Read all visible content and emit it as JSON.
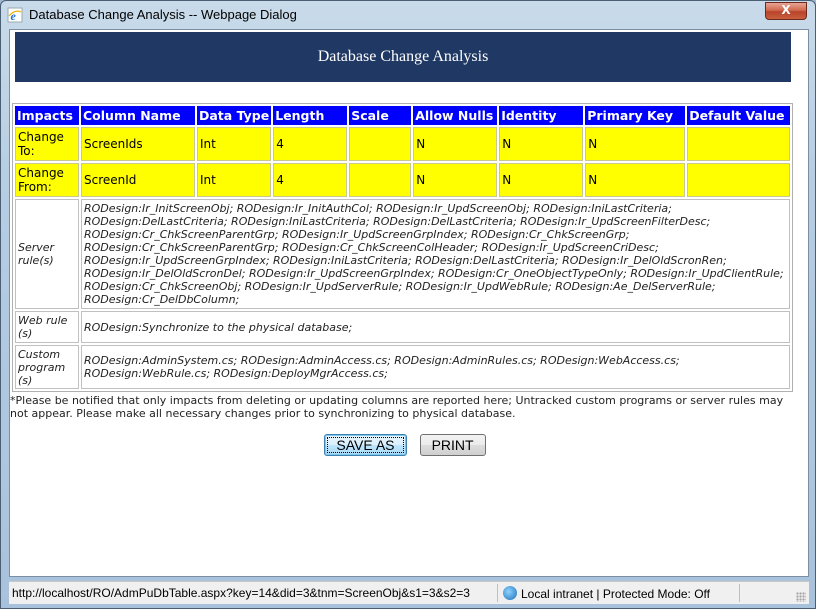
{
  "window": {
    "title": "Database Change Analysis -- Webpage Dialog",
    "close_label": "X"
  },
  "banner": {
    "title": "Database Change Analysis"
  },
  "table": {
    "headers": [
      "Impacts",
      "Column Name",
      "Data Type",
      "Length",
      "Scale",
      "Allow Nulls",
      "Identity",
      "Primary Key",
      "Default Value"
    ],
    "rows": [
      {
        "impact": "Change To:",
        "column_name": "ScreenIds",
        "data_type": "Int",
        "length": "4",
        "scale": "",
        "allow_nulls": "N",
        "identity": "N",
        "primary_key": "N",
        "default_value": ""
      },
      {
        "impact": "Change From:",
        "column_name": "ScreenId",
        "data_type": "Int",
        "length": "4",
        "scale": "",
        "allow_nulls": "N",
        "identity": "N",
        "primary_key": "N",
        "default_value": ""
      }
    ],
    "rules": [
      {
        "label": "Server rule(s)",
        "text": "RODesign:Ir_InitScreenObj; RODesign:Ir_InitAuthCol; RODesign:Ir_UpdScreenObj; RODesign:IniLastCriteria; RODesign:DelLastCriteria; RODesign:IniLastCriteria; RODesign:DelLastCriteria; RODesign:Ir_UpdScreenFilterDesc; RODesign:Cr_ChkScreenParentGrp; RODesign:Ir_UpdScreenGrpIndex; RODesign:Cr_ChkScreenGrp; RODesign:Cr_ChkScreenParentGrp; RODesign:Cr_ChkScreenColHeader; RODesign:Ir_UpdScreenCriDesc; RODesign:Ir_UpdScreenGrpIndex; RODesign:IniLastCriteria; RODesign:DelLastCriteria; RODesign:Ir_DelOldScronRen; RODesign:Ir_DelOldScronDel; RODesign:Ir_UpdScreenGrpIndex; RODesign:Cr_OneObjectTypeOnly; RODesign:Ir_UpdClientRule; RODesign:Cr_ChkScreenObj; RODesign:Ir_UpdServerRule; RODesign:Ir_UpdWebRule; RODesign:Ae_DelServerRule; RODesign:Cr_DelDbColumn;"
      },
      {
        "label": "Web rule (s)",
        "text": "RODesign:Synchronize to the physical database;"
      },
      {
        "label": "Custom program (s)",
        "text": "RODesign:AdminSystem.cs; RODesign:AdminAccess.cs; RODesign:AdminRules.cs; RODesign:WebAccess.cs; RODesign:WebRule.cs; RODesign:DeployMgrAccess.cs;"
      }
    ]
  },
  "note": "*Please be notified that only impacts from deleting or updating columns are reported here; Untracked custom programs or server rules may not appear. Please make all necessary changes prior to synchronizing to physical database.",
  "buttons": {
    "save_as": "SAVE AS",
    "print": "PRINT"
  },
  "statusbar": {
    "url": "http://localhost/RO/AdmPuDbTable.aspx?key=14&did=3&tnm=ScreenObj&s1=3&s2=3",
    "zone": "Local intranet | Protected Mode: Off"
  },
  "colors": {
    "banner": "#203864",
    "header": "#0000ff",
    "highlight": "#ffff00"
  }
}
